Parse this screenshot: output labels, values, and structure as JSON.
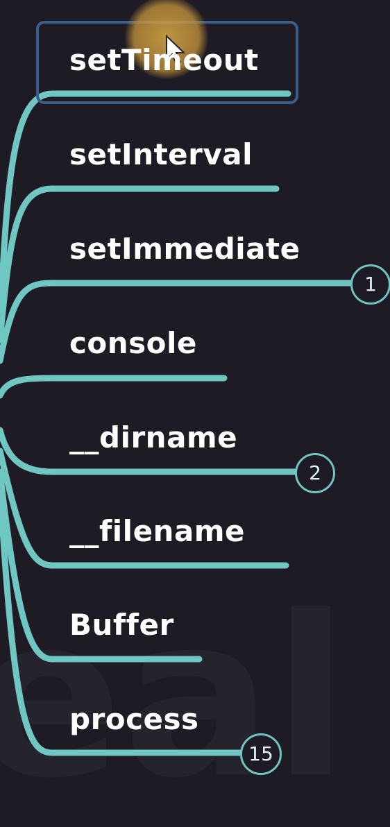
{
  "nodes": [
    {
      "label": "setTimeout"
    },
    {
      "label": "setInterval"
    },
    {
      "label": "setImmediate"
    },
    {
      "label": "console"
    },
    {
      "label": "__dirname"
    },
    {
      "label": "__filename"
    },
    {
      "label": "Buffer"
    },
    {
      "label": "process"
    }
  ],
  "badges": [
    "1",
    "2",
    "15"
  ],
  "colors": {
    "background": "#1e1b24",
    "branch": "#6fc6c2",
    "highlight": "#3a5f8c",
    "text": "#ffffff"
  }
}
